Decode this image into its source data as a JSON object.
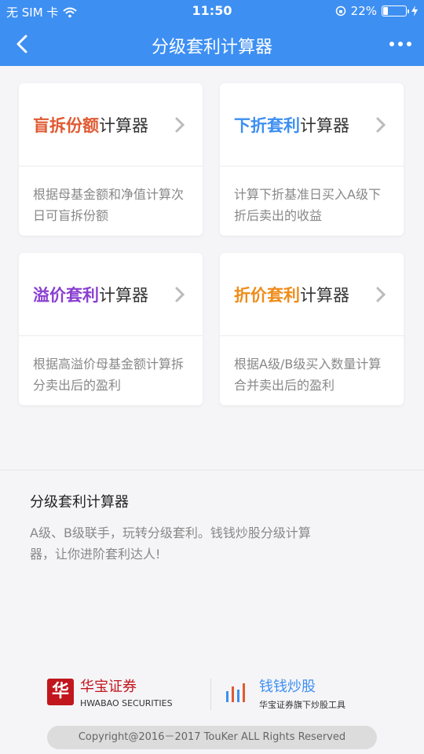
{
  "status_bar": {
    "carrier": "无 SIM 卡",
    "time": "11:50",
    "battery": "22%",
    "battery_level": 0.22
  },
  "header": {
    "title": "分级套利计算器"
  },
  "cards": [
    {
      "highlight": "盲拆份额",
      "suffix": "计算器",
      "color": "#e05a32",
      "description": "根据母基金额和净值计算次日可盲拆份额"
    },
    {
      "highlight": "下折套利",
      "suffix": "计算器",
      "color": "#3d8ff2",
      "description": "计算下折基准日买入A级下折后卖出的收益"
    },
    {
      "highlight": "溢价套利",
      "suffix": "计算器",
      "color": "#8a3fd1",
      "description": "根据高溢价母基金额计算拆分卖出后的盈利"
    },
    {
      "highlight": "折价套利",
      "suffix": "计算器",
      "color": "#ef8c1a",
      "description": "根据A级/B级买入数量计算合并卖出后的盈利"
    }
  ],
  "info": {
    "heading": "分级套利计算器",
    "text": "A级、B级联手，玩转分级套利。钱钱炒股分级计算器，让你进阶套利达人!"
  },
  "footer": {
    "brand1_name": "华宝证券",
    "brand1_sub": "HWABAO SECURITIES",
    "brand1_logo": "华",
    "brand2_name": "钱钱炒股",
    "brand2_sub": "华宝证券旗下炒股工具",
    "copyright": "Copyright@2016－2017 TouKer ALL Rights Reserved"
  },
  "colors": {
    "primary": "#3d8ff2",
    "brand_red": "#c2161e"
  }
}
